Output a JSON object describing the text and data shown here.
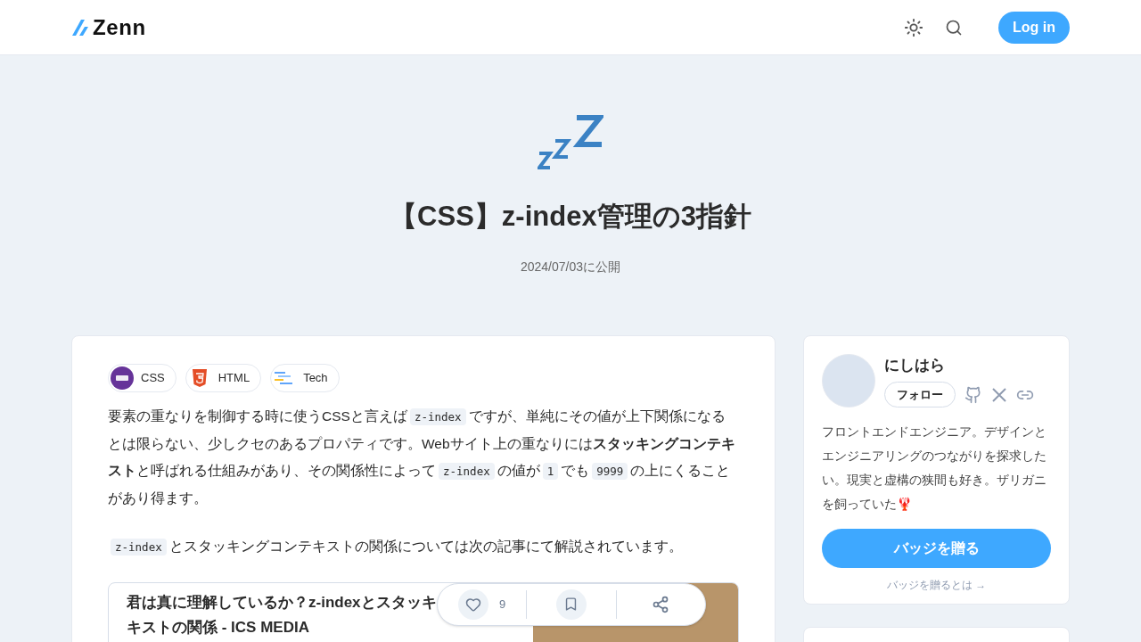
{
  "header": {
    "logo": "Zenn",
    "login": "Log in"
  },
  "article": {
    "title": "【CSS】z-index管理の3指針",
    "date": "2024/07/03に公開",
    "topics": [
      {
        "kind": "css",
        "label": "CSS"
      },
      {
        "kind": "html",
        "label": "HTML"
      },
      {
        "kind": "tech",
        "label": "Tech"
      }
    ],
    "paragraphs": [
      [
        {
          "kind": "text",
          "text": "要素の重なりを制御する時に使うCSSと言えば"
        },
        {
          "kind": "code",
          "text": "z-index"
        },
        {
          "kind": "text",
          "text": "ですが、単純にその値が上下関係になるとは限らない、少しクセのあるプロパティです。Webサイト上の重なりには**スタッキングコンテキスト**と呼ばれる仕組みがあり、その関係性によって"
        },
        {
          "kind": "code",
          "text": "z-index"
        },
        {
          "kind": "text",
          "text": "の値が"
        },
        {
          "kind": "code",
          "text": "1"
        },
        {
          "kind": "text",
          "text": "でも"
        },
        {
          "kind": "code",
          "text": "9999"
        },
        {
          "kind": "text",
          "text": "の上にくることがあり得ます。"
        }
      ],
      [
        {
          "kind": "code",
          "text": "z-index"
        },
        {
          "kind": "text",
          "text": "とスタッキングコンテキストの関係については次の記事にて解説されています。"
        }
      ]
    ],
    "link_card": {
      "title_lines": [
        "君は真に理解しているか？z-indexとスタッキ",
        "キストの関係 - ICS MEDIA"
      ]
    }
  },
  "actions": {
    "likes": "9"
  },
  "author": {
    "name": "にしはら",
    "follow": "フォロー",
    "bio": "フロントエンドエンジニア。デザインとエンジニアリングのつながりを探求したい。現実と虚構の狭間も好き。ザリガニを飼っていた🦞",
    "badge_button": "バッジを贈る",
    "badge_link": "バッジを贈るとは →"
  }
}
